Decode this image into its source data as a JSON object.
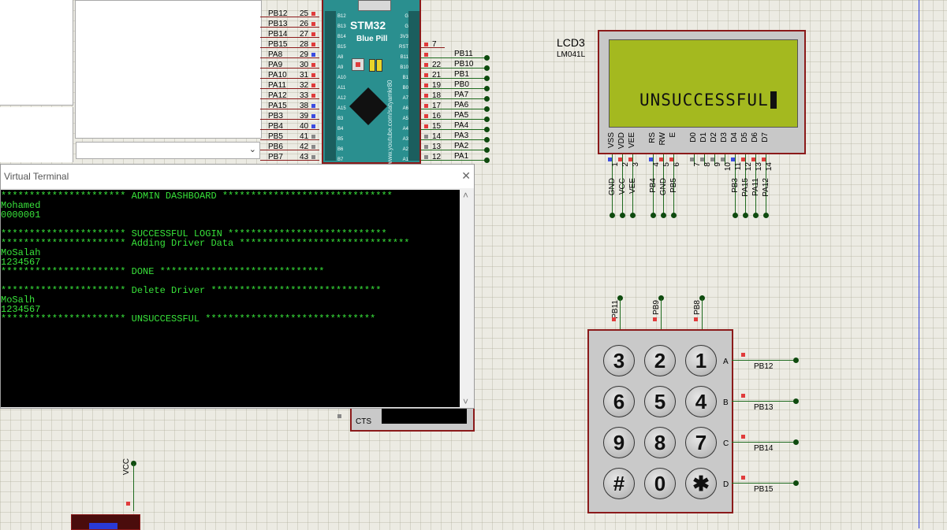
{
  "colors": {
    "grid_bg": "#ecebe3",
    "board_teal": "#2a8f8f",
    "lcd_green": "#a4b91f",
    "terminal_bg": "#000000",
    "terminal_text": "#38e23a",
    "wire": "#1f6b1f",
    "component_border": "#8b1a1a"
  },
  "stm32": {
    "title": "STM32",
    "subtitle": "Blue Pill",
    "watermark": "www.youtube.com/satyamkr80",
    "left_pins": [
      {
        "label": "PB12",
        "num": "25",
        "inner": "B12"
      },
      {
        "label": "PB13",
        "num": "26",
        "inner": "B13"
      },
      {
        "label": "PB14",
        "num": "27",
        "inner": "B14"
      },
      {
        "label": "PB15",
        "num": "28",
        "inner": "B15"
      },
      {
        "label": "PA8",
        "num": "29",
        "inner": "A8"
      },
      {
        "label": "PA9",
        "num": "30",
        "inner": "A9"
      },
      {
        "label": "PA10",
        "num": "31",
        "inner": "A10"
      },
      {
        "label": "PA11",
        "num": "32",
        "inner": "A11"
      },
      {
        "label": "PA12",
        "num": "33",
        "inner": "A12"
      },
      {
        "label": "PA15",
        "num": "38",
        "inner": "A15"
      },
      {
        "label": "PB3",
        "num": "39",
        "inner": "B3"
      },
      {
        "label": "PB4",
        "num": "40",
        "inner": "B4"
      },
      {
        "label": "PB5",
        "num": "41",
        "inner": "B5"
      },
      {
        "label": "PB6",
        "num": "42",
        "inner": "B6"
      },
      {
        "label": "PB7",
        "num": "43",
        "inner": "B7"
      }
    ],
    "right_pins": [
      {
        "label": "",
        "num": "",
        "inner": "G"
      },
      {
        "label": "",
        "num": "",
        "inner": "G"
      },
      {
        "label": "",
        "num": "",
        "inner": "3V3"
      },
      {
        "label": "",
        "num": "7",
        "inner": "RST"
      },
      {
        "label": "PB11",
        "num": "",
        "inner": "B11"
      },
      {
        "label": "PB10",
        "num": "22",
        "inner": "B10"
      },
      {
        "label": "PB1",
        "num": "21",
        "inner": "B1"
      },
      {
        "label": "PB0",
        "num": "19",
        "inner": "B0"
      },
      {
        "label": "PA7",
        "num": "18",
        "inner": "A7"
      },
      {
        "label": "PA6",
        "num": "17",
        "inner": "A6"
      },
      {
        "label": "PA5",
        "num": "16",
        "inner": "A5"
      },
      {
        "label": "PA4",
        "num": "15",
        "inner": "A4"
      },
      {
        "label": "PA3",
        "num": "14",
        "inner": "A3"
      },
      {
        "label": "PA2",
        "num": "13",
        "inner": "A2"
      },
      {
        "label": "PA1",
        "num": "12",
        "inner": "A1"
      }
    ]
  },
  "lcd": {
    "name": "LCD3",
    "model": "LM041L",
    "display_text": "UNSUCCESSFUL",
    "pins_top": [
      "VSS",
      "VDD",
      "VEE",
      "",
      "RS",
      "RW",
      "E",
      "",
      "D0",
      "D1",
      "D2",
      "D3",
      "D4",
      "D5",
      "D6",
      "D7"
    ],
    "pin_nums": [
      "1",
      "2",
      "3",
      "",
      "4",
      "5",
      "6",
      "",
      "7",
      "8",
      "9",
      "10",
      "11",
      "12",
      "13",
      "14"
    ],
    "nets": [
      "GND",
      "VCC",
      "VEE",
      "",
      "PB4",
      "GND",
      "PB5",
      "",
      "",
      "",
      "",
      "",
      "PB3",
      "PA15",
      "PA11",
      "PA12"
    ]
  },
  "keypad": {
    "cols": [
      {
        "num": "3",
        "net": "PB11"
      },
      {
        "num": "2",
        "net": "PB9"
      },
      {
        "num": "1",
        "net": "PB8"
      }
    ],
    "rows": [
      {
        "letter": "A",
        "net": "PB12",
        "keys": [
          "3",
          "2",
          "1"
        ]
      },
      {
        "letter": "B",
        "net": "PB13",
        "keys": [
          "6",
          "5",
          "4"
        ]
      },
      {
        "letter": "C",
        "net": "PB14",
        "keys": [
          "9",
          "8",
          "7"
        ]
      },
      {
        "letter": "D",
        "net": "PB15",
        "keys": [
          "#",
          "0",
          "✱"
        ]
      }
    ]
  },
  "terminal": {
    "title": "Virtual Terminal",
    "close_label": "✕",
    "lines": [
      "********************** ADMIN DASHBOARD ******************************",
      "Mohamed",
      "0000001",
      "",
      "********************** SUCCESSFUL LOGIN ****************************",
      "********************** Adding Driver Data ******************************",
      "MoSalah",
      "1234567",
      "********************** DONE *****************************",
      "",
      "********************** Delete Driver ******************************",
      "MoSalh",
      "1234567",
      "********************** UNSUCCESSFUL ******************************"
    ],
    "scroll_up": "˄",
    "scroll_down": "˅"
  },
  "misc": {
    "cts_label": "CTS",
    "vcc_label": "VCC"
  }
}
